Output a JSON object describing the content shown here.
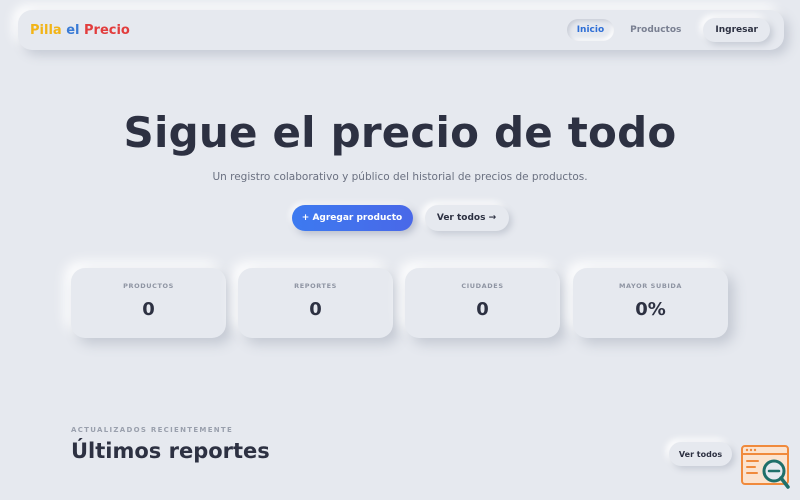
{
  "navbar": {
    "logo": {
      "word1": "Pilla",
      "word2": "el",
      "word3": "Precio"
    },
    "links": [
      {
        "label": "Inicio",
        "active": true
      },
      {
        "label": "Productos",
        "active": false
      }
    ],
    "login_label": "Ingresar"
  },
  "hero": {
    "title": "Sigue el precio de todo",
    "subtitle": "Un registro colaborativo y público del historial de precios de productos.",
    "primary_cta": "+ Agregar producto",
    "secondary_cta": "Ver todos →"
  },
  "stats": [
    {
      "label": "PRODUCTOS",
      "value": "0"
    },
    {
      "label": "REPORTES",
      "value": "0"
    },
    {
      "label": "CIUDADES",
      "value": "0"
    },
    {
      "label": "MAYOR SUBIDA",
      "value": "0%"
    }
  ],
  "recent": {
    "eyebrow": "ACTUALIZADOS RECIENTEMENTE",
    "title": "Últimos reportes",
    "view_all": "Ver todos"
  },
  "colors": {
    "background": "#e6e9ef",
    "accent": "#3d7af0",
    "logo_yellow": "#f2b417",
    "logo_blue": "#3a7bd5",
    "logo_red": "#e23d3d",
    "widget_orange": "#f08a3c",
    "widget_teal": "#1f6f6a"
  },
  "icons": {
    "corner_widget": "browser-search-icon"
  }
}
